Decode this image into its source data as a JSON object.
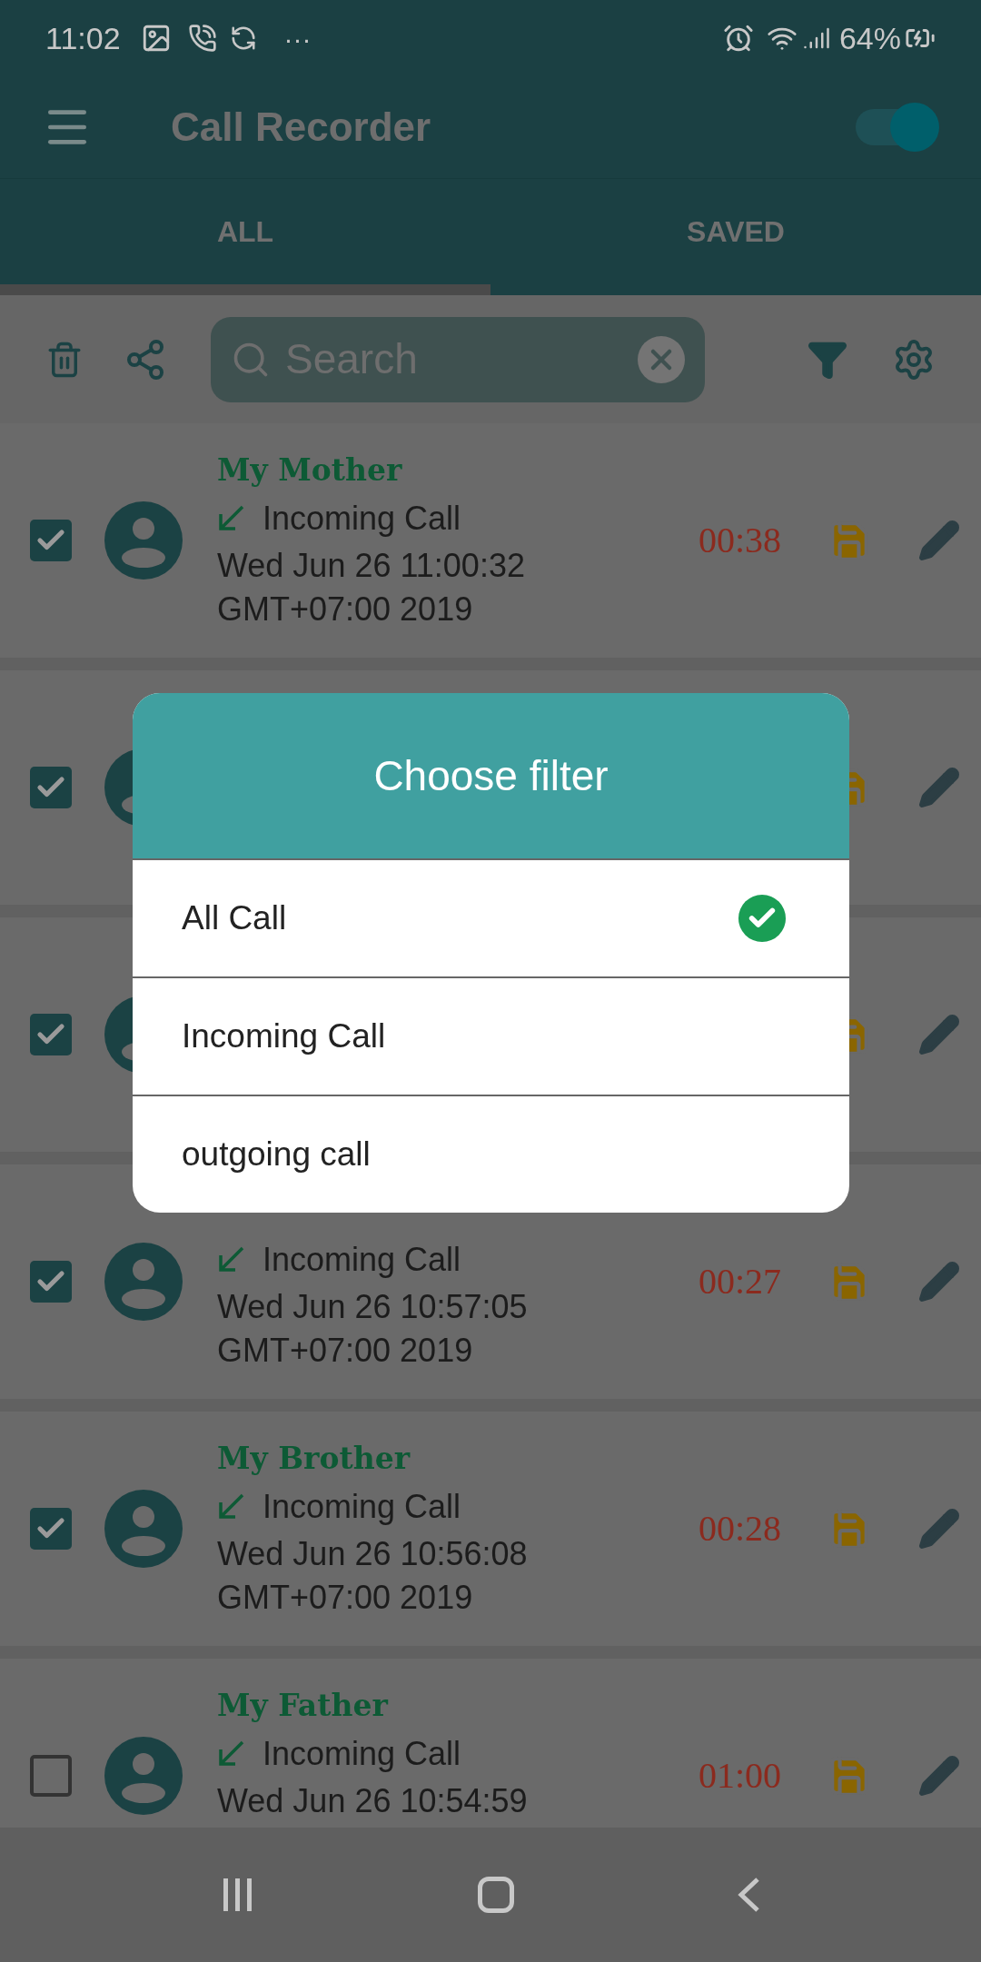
{
  "status_bar": {
    "time": "11:02",
    "more": "···",
    "battery": "64%"
  },
  "app_bar": {
    "title": "Call Recorder",
    "recording_on": true
  },
  "tabs": [
    {
      "label": "ALL",
      "selected": true
    },
    {
      "label": "SAVED",
      "selected": false
    }
  ],
  "search": {
    "placeholder": "Search"
  },
  "calls": [
    {
      "checked": true,
      "name": "My Mother",
      "call_type": "Incoming Call",
      "date_lines": [
        "Wed Jun 26 11:00:32",
        "GMT+07:00 2019"
      ],
      "duration": "00:38"
    },
    {
      "checked": true
    },
    {
      "checked": true
    },
    {
      "checked": true,
      "call_type": "Incoming Call",
      "date_lines": [
        "Wed Jun 26 10:57:05",
        "GMT+07:00 2019"
      ],
      "duration": "00:27"
    },
    {
      "checked": true,
      "name": "My Brother",
      "call_type": "Incoming Call",
      "date_lines": [
        "Wed Jun 26 10:56:08",
        "GMT+07:00 2019"
      ],
      "duration": "00:28"
    },
    {
      "checked": false,
      "name": "My Father",
      "call_type": "Incoming Call",
      "date_lines": [
        "Wed Jun 26 10:54:59"
      ],
      "duration": "01:00"
    }
  ],
  "dialog": {
    "title": "Choose filter",
    "options": [
      {
        "label": "All Call",
        "selected": true
      },
      {
        "label": "Incoming Call",
        "selected": false
      },
      {
        "label": "outgoing call",
        "selected": false
      }
    ]
  }
}
